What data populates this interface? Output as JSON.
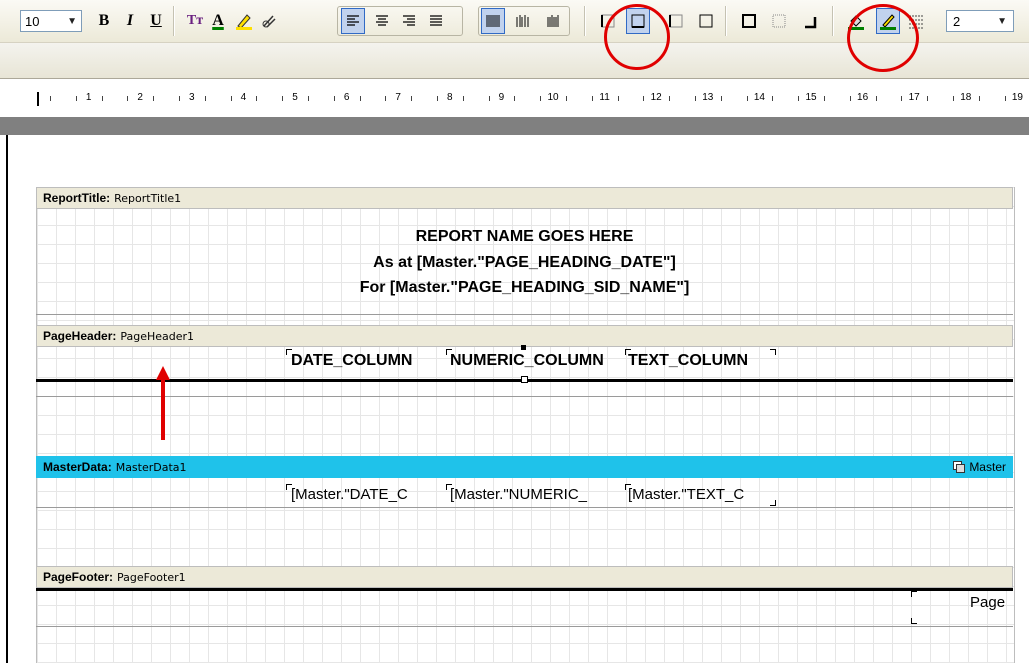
{
  "toolbar": {
    "font_size": "10",
    "bold": "B",
    "italic": "I",
    "underline": "U",
    "font_style": "Tт",
    "font_color": "A",
    "highlight": "✎",
    "clear_format": "⊘",
    "align_left": "≡",
    "align_center": "≡",
    "align_right": "≡",
    "align_justify": "≡",
    "barcode_1": "||||",
    "barcode_2": "|||",
    "barcode_3": "||||",
    "frame_left": "",
    "frame_bottom": "",
    "frame_top": "",
    "frame_right": "",
    "frame_all": "",
    "frame_none": "",
    "frame_shadow": "",
    "fill_color": "",
    "line_color": "",
    "line_style": "",
    "line_width": "2"
  },
  "ruler": {
    "labels": [
      "1",
      "2",
      "3",
      "4",
      "5",
      "6",
      "7",
      "8",
      "9",
      "10",
      "11",
      "12",
      "13",
      "14",
      "15",
      "16",
      "17",
      "18",
      "19"
    ]
  },
  "bands": {
    "report_title": {
      "type": "ReportTitle:",
      "name": "ReportTitle1"
    },
    "page_header": {
      "type": "PageHeader:",
      "name": "PageHeader1"
    },
    "master_data": {
      "type": "MasterData:",
      "name": "MasterData1",
      "dataset": "Master"
    },
    "page_footer": {
      "type": "PageFooter:",
      "name": "PageFooter1"
    }
  },
  "title_lines": [
    "REPORT NAME GOES HERE",
    "As at [Master.\"PAGE_HEADING_DATE\"]",
    "For [Master.\"PAGE_HEADING_SID_NAME\"]"
  ],
  "columns": {
    "headers": [
      "DATE_COLUMN",
      "NUMERIC_COLUMN",
      "TEXT_COLUMN"
    ],
    "data": [
      "[Master.\"DATE_C",
      "[Master.\"NUMERIC_",
      "[Master.\"TEXT_C"
    ]
  },
  "footer": {
    "text": "Page"
  },
  "colors": {
    "master_band": "#1fc2ea",
    "annotation_red": "#e00000"
  }
}
